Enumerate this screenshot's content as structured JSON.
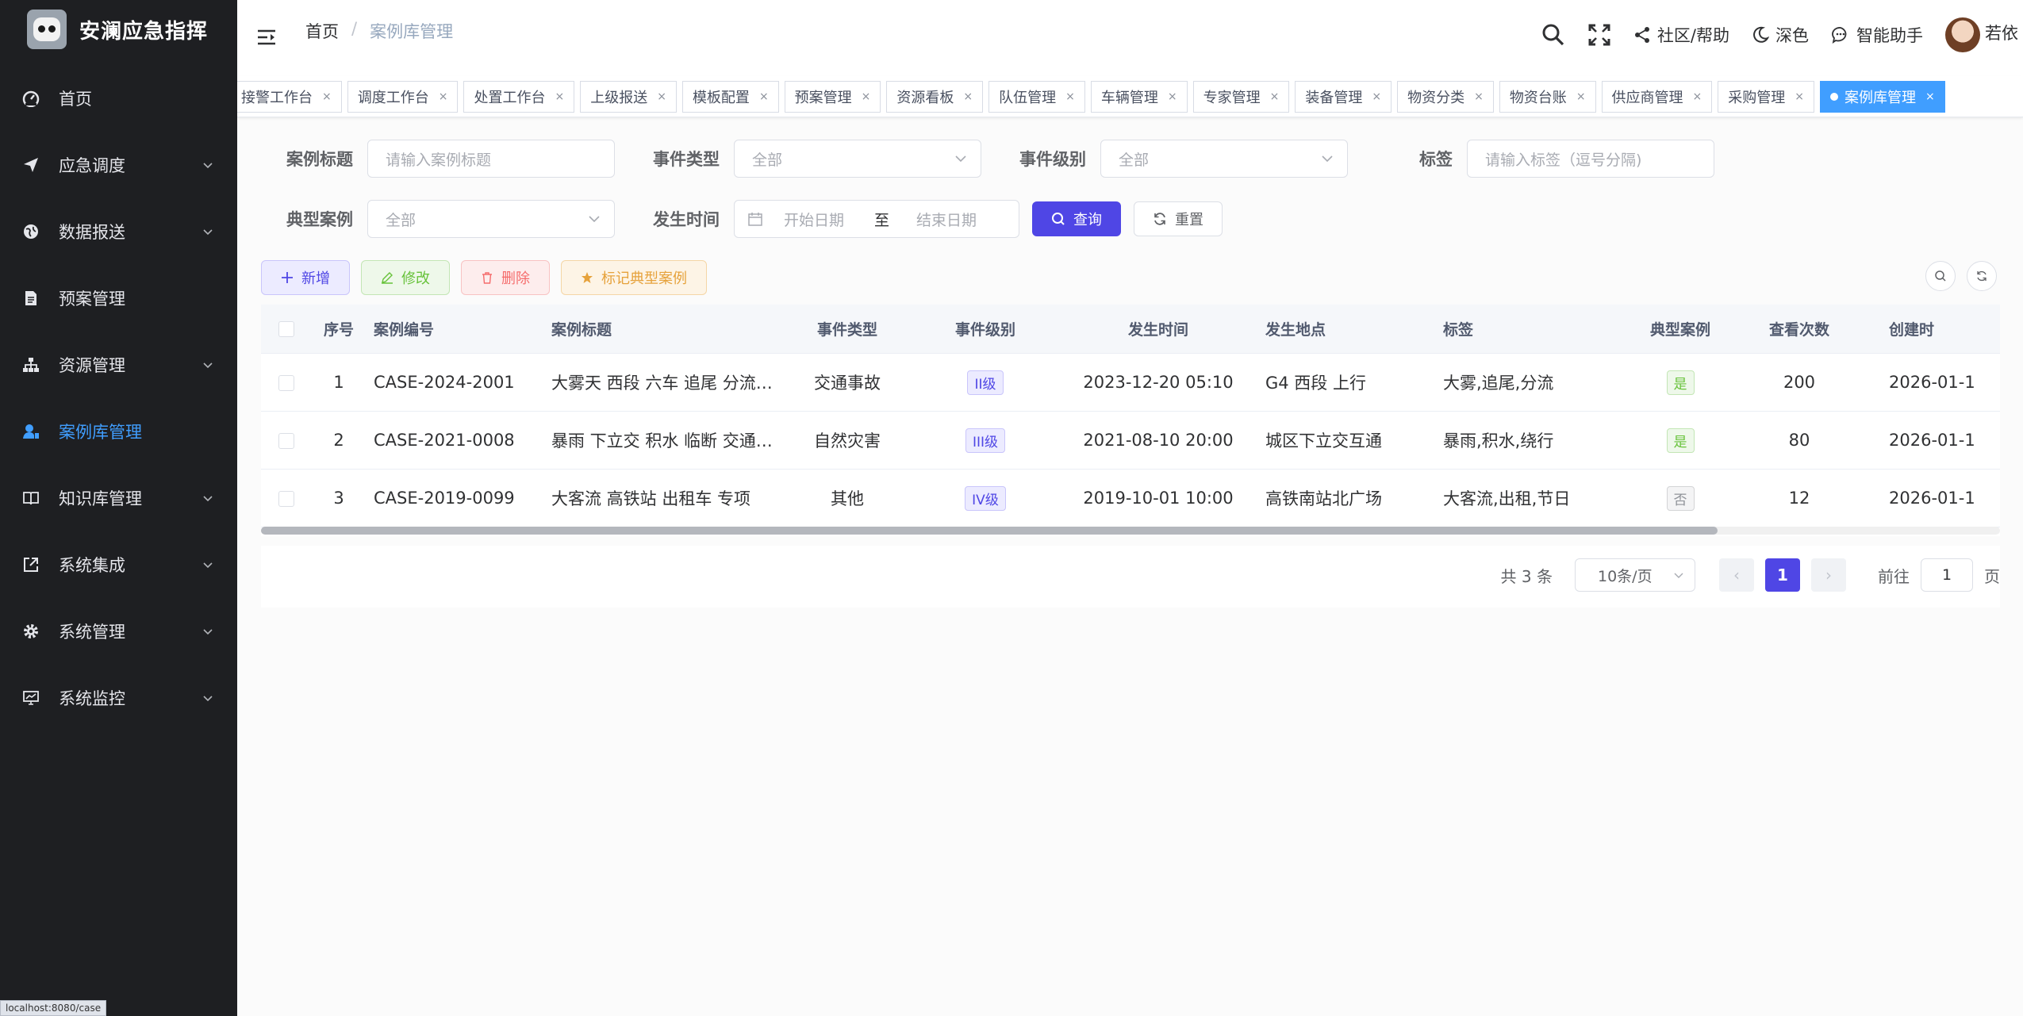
{
  "app": {
    "title": "安澜应急指挥"
  },
  "sidebar": {
    "items": [
      {
        "label": "首页",
        "icon": "dashboard-icon",
        "expandable": false,
        "active": false
      },
      {
        "label": "应急调度",
        "icon": "send-icon",
        "expandable": true,
        "active": false
      },
      {
        "label": "数据报送",
        "icon": "globe-icon",
        "expandable": true,
        "active": false
      },
      {
        "label": "预案管理",
        "icon": "document-icon",
        "expandable": false,
        "active": false
      },
      {
        "label": "资源管理",
        "icon": "tree-icon",
        "expandable": true,
        "active": false
      },
      {
        "label": "案例库管理",
        "icon": "user-icon",
        "expandable": false,
        "active": true
      },
      {
        "label": "知识库管理",
        "icon": "book-icon",
        "expandable": true,
        "active": false
      },
      {
        "label": "系统集成",
        "icon": "external-link-icon",
        "expandable": true,
        "active": false
      },
      {
        "label": "系统管理",
        "icon": "gear-icon",
        "expandable": true,
        "active": false
      },
      {
        "label": "系统监控",
        "icon": "monitor-icon",
        "expandable": true,
        "active": false
      }
    ]
  },
  "header": {
    "breadcrumb": {
      "home": "首页",
      "separator": "/",
      "current": "案例库管理"
    },
    "community": "社区/帮助",
    "theme": "深色",
    "assistant": "智能助手",
    "username": "若依"
  },
  "tags": [
    {
      "label": "接警工作台",
      "active": false
    },
    {
      "label": "调度工作台",
      "active": false
    },
    {
      "label": "处置工作台",
      "active": false
    },
    {
      "label": "上级报送",
      "active": false
    },
    {
      "label": "模板配置",
      "active": false
    },
    {
      "label": "预案管理",
      "active": false
    },
    {
      "label": "资源看板",
      "active": false
    },
    {
      "label": "队伍管理",
      "active": false
    },
    {
      "label": "车辆管理",
      "active": false
    },
    {
      "label": "专家管理",
      "active": false
    },
    {
      "label": "装备管理",
      "active": false
    },
    {
      "label": "物资分类",
      "active": false
    },
    {
      "label": "物资台账",
      "active": false
    },
    {
      "label": "供应商管理",
      "active": false
    },
    {
      "label": "采购管理",
      "active": false
    },
    {
      "label": "案例库管理",
      "active": true
    }
  ],
  "filters": {
    "case_title": {
      "label": "案例标题",
      "placeholder": "请输入案例标题"
    },
    "event_type": {
      "label": "事件类型",
      "value": "全部"
    },
    "event_level": {
      "label": "事件级别",
      "value": "全部"
    },
    "tags": {
      "label": "标签",
      "placeholder": "请输入标签（逗号分隔)"
    },
    "typical": {
      "label": "典型案例",
      "value": "全部"
    },
    "occur_time": {
      "label": "发生时间",
      "start": "开始日期",
      "to": "至",
      "end": "结束日期"
    },
    "search_label": "查询",
    "reset_label": "重置"
  },
  "toolbar": {
    "add_label": "新增",
    "edit_label": "修改",
    "delete_label": "删除",
    "mark_label": "标记典型案例"
  },
  "table": {
    "columns": [
      "序号",
      "案例编号",
      "案例标题",
      "事件类型",
      "事件级别",
      "发生时间",
      "发生地点",
      "标签",
      "典型案例",
      "查看次数",
      "创建时"
    ],
    "rows": [
      {
        "no": "1",
        "code": "CASE-2024-2001",
        "title": "大雾天 西段 六车 追尾 分流…",
        "type": "交通事故",
        "level": "II级",
        "time": "2023-12-20 05:10",
        "place": "G4 西段 上行",
        "tags": "大雾,追尾,分流",
        "typical": "是",
        "views": "200",
        "created": "2026-01-1"
      },
      {
        "no": "2",
        "code": "CASE-2021-0008",
        "title": "暴雨 下立交 积水 临断 交通…",
        "type": "自然灾害",
        "level": "III级",
        "time": "2021-08-10 20:00",
        "place": "城区下立交互通",
        "tags": "暴雨,积水,绕行",
        "typical": "是",
        "views": "80",
        "created": "2026-01-1"
      },
      {
        "no": "3",
        "code": "CASE-2019-0099",
        "title": "大客流 高铁站 出租车 专项",
        "type": "其他",
        "level": "IV级",
        "time": "2019-10-01 10:00",
        "place": "高铁南站北广场",
        "tags": "大客流,出租,节日",
        "typical": "否",
        "views": "12",
        "created": "2026-01-1"
      }
    ]
  },
  "pagination": {
    "total_text": "共 3 条",
    "page_size": "10条/页",
    "current_page": "1",
    "goto_label": "前往",
    "goto_value": "1",
    "page_suffix": "页"
  },
  "statusbar": {
    "url": "localhost:8080/case"
  },
  "colors": {
    "sidebar_bg": "#1e1f22",
    "primary": "#4f46e5",
    "active_tag": "#409eff",
    "active_menu": "#409eff"
  }
}
